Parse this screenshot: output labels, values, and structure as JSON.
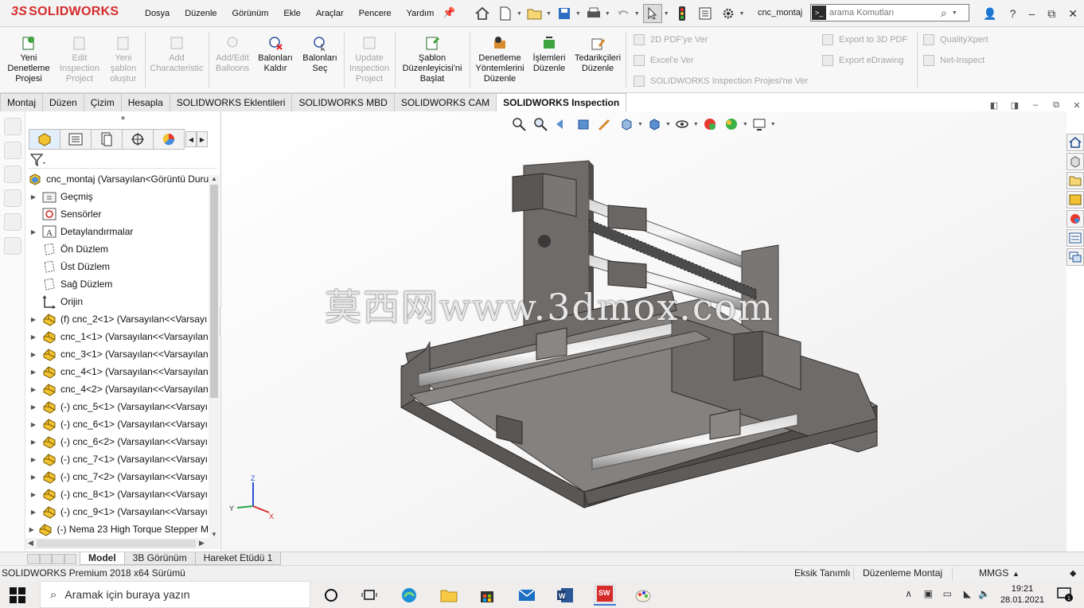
{
  "app": {
    "brand_prefix": "3S",
    "brand_name": "SOLIDWORKS",
    "document_name": "cnc_montaj"
  },
  "menu": [
    "Dosya",
    "Düzenle",
    "Görünüm",
    "Ekle",
    "Araçlar",
    "Pencere",
    "Yardım"
  ],
  "search": {
    "placeholder": "arama Komutları",
    "prefix": ">_"
  },
  "ribbon": {
    "buttons": [
      {
        "label": "Yeni Denetleme Projesi",
        "enabled": true
      },
      {
        "label": "Edit Inspection Project",
        "enabled": false
      },
      {
        "label": "Yeni şablon oluştur",
        "enabled": false
      },
      {
        "label": "Add Characteristic",
        "enabled": false
      },
      {
        "label": "Add/Edit Balloons",
        "enabled": false
      },
      {
        "label": "Balonları Kaldır",
        "enabled": true
      },
      {
        "label": "Balonları Seç",
        "enabled": true
      },
      {
        "label": "Update Inspection Project",
        "enabled": false
      },
      {
        "label": "Şablon Düzenleyicisi'ni Başlat",
        "enabled": true
      },
      {
        "label": "Denetleme Yöntemlerini Düzenle",
        "enabled": true
      },
      {
        "label": "İşlemleri Düzenle",
        "enabled": true
      },
      {
        "label": "Tedarikçileri Düzenle",
        "enabled": true
      }
    ],
    "small_buttons": [
      "2D PDF'ye Ver",
      "Excel'e Ver",
      "SOLIDWORKS Inspection Projesi'ne Ver",
      "Export to 3D PDF",
      "Export eDrawing",
      "QualityXpert",
      "Net-Inspect"
    ]
  },
  "command_tabs": [
    {
      "label": "Montaj",
      "active": false
    },
    {
      "label": "Düzen",
      "active": false
    },
    {
      "label": "Çizim",
      "active": false
    },
    {
      "label": "Hesapla",
      "active": false
    },
    {
      "label": "SOLIDWORKS Eklentileri",
      "active": false
    },
    {
      "label": "SOLIDWORKS MBD",
      "active": false
    },
    {
      "label": "SOLIDWORKS CAM",
      "active": false
    },
    {
      "label": "SOLIDWORKS Inspection",
      "active": true
    }
  ],
  "tree": {
    "root": "cnc_montaj  (Varsayılan<Görüntü Duru",
    "items": [
      {
        "label": "Geçmiş",
        "icon": "history-folder-icon",
        "expand": true
      },
      {
        "label": "Sensörler",
        "icon": "sensor-icon",
        "expand": false
      },
      {
        "label": "Detaylandırmalar",
        "icon": "annotations-icon",
        "expand": true
      },
      {
        "label": "Ön Düzlem",
        "icon": "plane-icon",
        "expand": false
      },
      {
        "label": "Üst Düzlem",
        "icon": "plane-icon",
        "expand": false
      },
      {
        "label": "Sağ Düzlem",
        "icon": "plane-icon",
        "expand": false
      },
      {
        "label": "Orijin",
        "icon": "origin-icon",
        "expand": false
      },
      {
        "label": "(f) cnc_2<1> (Varsayılan<<Varsayı",
        "icon": "part-icon",
        "expand": true
      },
      {
        "label": "cnc_1<1> (Varsayılan<<Varsayılan",
        "icon": "part-icon",
        "expand": true
      },
      {
        "label": "cnc_3<1> (Varsayılan<<Varsayılan",
        "icon": "part-icon",
        "expand": true
      },
      {
        "label": "cnc_4<1> (Varsayılan<<Varsayılan",
        "icon": "part-icon",
        "expand": true
      },
      {
        "label": "cnc_4<2> (Varsayılan<<Varsayılan",
        "icon": "part-icon",
        "expand": true
      },
      {
        "label": "(-) cnc_5<1> (Varsayılan<<Varsayı",
        "icon": "part-icon",
        "expand": true
      },
      {
        "label": "(-) cnc_6<1> (Varsayılan<<Varsayı",
        "icon": "part-icon",
        "expand": true
      },
      {
        "label": "(-) cnc_6<2> (Varsayılan<<Varsayı",
        "icon": "part-icon",
        "expand": true
      },
      {
        "label": "(-) cnc_7<1> (Varsayılan<<Varsayı",
        "icon": "part-icon",
        "expand": true
      },
      {
        "label": "(-) cnc_7<2> (Varsayılan<<Varsayı",
        "icon": "part-icon",
        "expand": true
      },
      {
        "label": "(-) cnc_8<1> (Varsayılan<<Varsayı",
        "icon": "part-icon",
        "expand": true
      },
      {
        "label": "(-) cnc_9<1> (Varsayılan<<Varsayı",
        "icon": "part-icon",
        "expand": true
      },
      {
        "label": "(-) Nema 23 High Torque Stepper M",
        "icon": "part-icon",
        "expand": true
      }
    ]
  },
  "watermark": "莫西网www.3dmox.com",
  "axes": {
    "x": "X",
    "y": "Y",
    "z": "Z"
  },
  "bottom_tabs": [
    {
      "label": "Model",
      "active": true
    },
    {
      "label": "3B Görünüm",
      "active": false
    },
    {
      "label": "Hareket Etüdü 1",
      "active": false
    }
  ],
  "status": {
    "version": "SOLIDWORKS Premium 2018 x64 Sürümü",
    "definition": "Eksik Tanımlı",
    "mode": "Düzenleme Montaj",
    "units": "MMGS"
  },
  "taskbar": {
    "search_placeholder": "Aramak için buraya yazın",
    "time": "19:21",
    "date": "28.01.2021",
    "notifications": "1"
  },
  "colors": {
    "brand": "#d62b2b",
    "model_face": "#7f7b78",
    "model_dark": "#5a5654"
  }
}
